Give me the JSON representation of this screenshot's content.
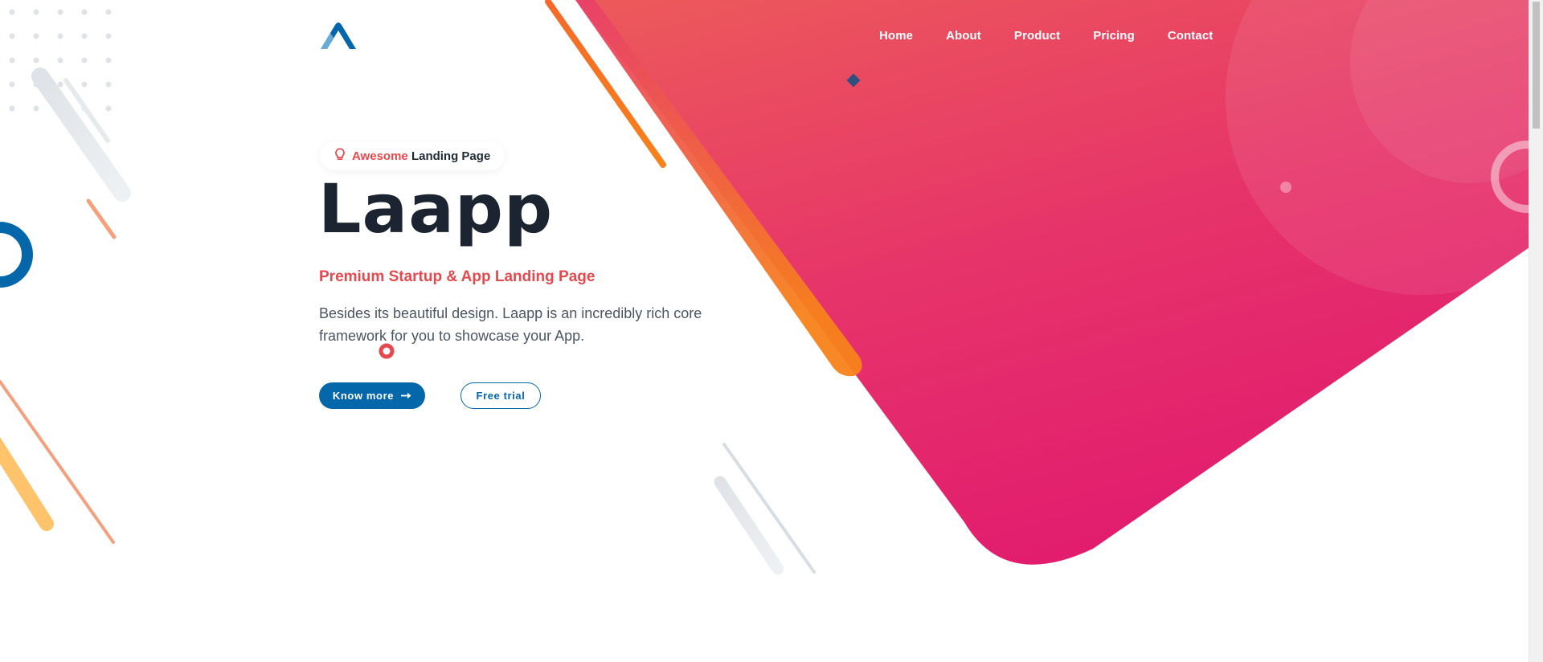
{
  "header": {
    "logo_icon": "caret-up-logo",
    "nav": [
      {
        "label": "Home"
      },
      {
        "label": "About"
      },
      {
        "label": "Product"
      },
      {
        "label": "Pricing"
      },
      {
        "label": "Contact"
      }
    ]
  },
  "hero": {
    "badge": {
      "icon": "lightbulb-icon",
      "accent": "Awesome",
      "text": "Landing Page"
    },
    "title": "Laapp",
    "subtitle": "Premium Startup & App Landing Page",
    "description": "Besides its beautiful design. Laapp is an incredibly rich core framework for you to showcase your App.",
    "buttons": {
      "primary": {
        "label": "Know more",
        "icon": "arrow-right-icon"
      },
      "secondary": {
        "label": "Free trial"
      }
    }
  },
  "colors": {
    "brand_blue": "#0467a9",
    "accent_red": "#e5484d",
    "gradient_top": "#ec5a5a",
    "gradient_bottom": "#e21d6e",
    "orange": "#f7821b",
    "heading": "#1b2430"
  }
}
